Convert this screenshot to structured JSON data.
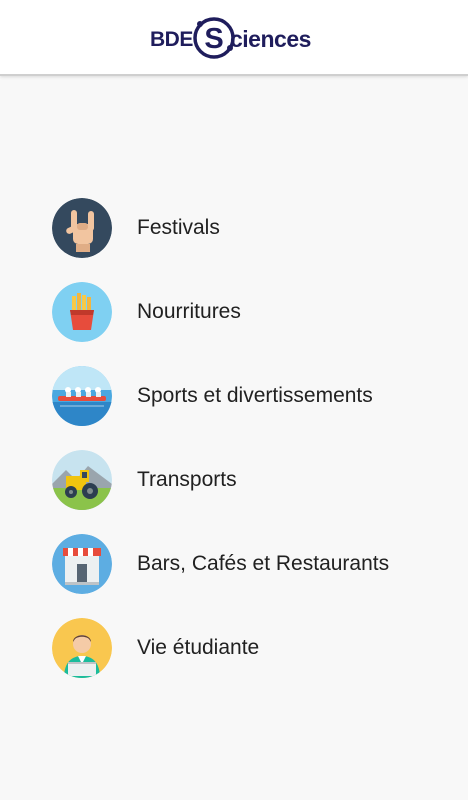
{
  "header": {
    "logo_prefix": "BDE",
    "logo_letter": "S",
    "logo_suffix": "ciences",
    "brand_color": "#1f1d5c"
  },
  "menu": {
    "items": [
      {
        "label": "Festivals",
        "icon": "rock-hand-icon"
      },
      {
        "label": "Nourritures",
        "icon": "fries-icon"
      },
      {
        "label": "Sports et divertissements",
        "icon": "rowing-icon"
      },
      {
        "label": "Transports",
        "icon": "tractor-icon"
      },
      {
        "label": "Bars, Cafés et Restaurants",
        "icon": "storefront-icon"
      },
      {
        "label": "Vie étudiante",
        "icon": "student-icon"
      }
    ]
  }
}
